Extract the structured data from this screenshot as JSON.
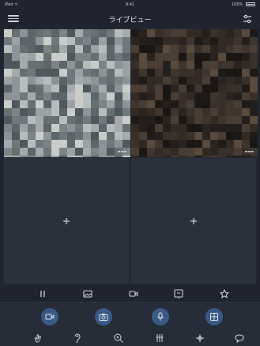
{
  "status_bar": {
    "left": "iPad ᯤ",
    "time": "9:41",
    "battery": "100%"
  },
  "nav": {
    "title": "ライブビュー"
  },
  "cells": [
    {
      "state": "live",
      "stamp": "▬▬▬"
    },
    {
      "state": "live",
      "stamp": "▬▬▬"
    },
    {
      "state": "empty",
      "add_icon": "plus-icon"
    },
    {
      "state": "empty",
      "add_icon": "plus-icon"
    }
  ],
  "toolbar_icons": [
    "pause-icon",
    "image-icon",
    "record-icon",
    "board-icon",
    "star-icon"
  ],
  "control_buttons": [
    "video-camera-icon",
    "snapshot-camera-icon",
    "microphone-icon",
    "layout-grid-icon"
  ],
  "bottom_icons": [
    "hand-icon",
    "ear-icon",
    "zoom-icon",
    "tool-icon",
    "drone-icon",
    "chat-icon"
  ],
  "colors": {
    "background": "#1f2430",
    "cell": "#2a303c",
    "accent": "#3a5a86",
    "icon": "#cfd4dc"
  }
}
